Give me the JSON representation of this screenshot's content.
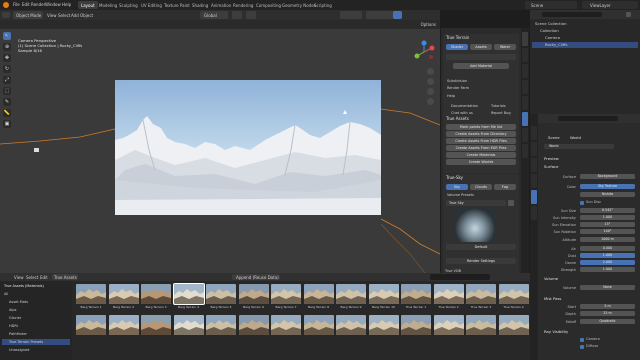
{
  "topbar": {
    "menus": [
      "File",
      "Edit",
      "Render",
      "Window",
      "Help"
    ],
    "workspaces": [
      "Layout",
      "Modeling",
      "Sculpting",
      "UV Editing",
      "Texture Paint",
      "Shading",
      "Animation",
      "Rendering",
      "Compositing",
      "Geometry Nodes",
      "Scripting"
    ],
    "active_workspace": "Layout",
    "scene_label": "Scene",
    "viewlayer_label": "ViewLayer"
  },
  "viewport": {
    "header": {
      "mode": "Object Mode",
      "menus": [
        "View",
        "Select",
        "Add",
        "Object"
      ],
      "orientation": "Global",
      "options": "Options"
    },
    "overlay_text": {
      "line1": "Camera Perspective",
      "line2": "(1) Scene Collection | Rocky_Cliffs",
      "line3": "Sample 8/16"
    },
    "colors": {
      "terrain_edge": "#d07a2a",
      "selection": "#4772b3"
    }
  },
  "npanel": {
    "true_terrain": {
      "title": "True Terrain",
      "tabs": [
        "Shader",
        "Assets",
        "Water"
      ],
      "active_tab": "Shader",
      "add_material": "Add Material",
      "subpanels": [
        "Subdivision",
        "Render Farm",
        "Help"
      ],
      "doc_button": "Documentation",
      "tutorials_button": "Tutorials",
      "chat_button": "Chat with us",
      "report_button": "Report Bug"
    },
    "true_assets": {
      "title": "True Assets",
      "buttons": [
        "Mark points from file list",
        "Create Assets From Directory",
        "Create Assets From HDR Files",
        "Create Assets From EXR Files",
        "Create Materials",
        "Create Worlds"
      ]
    },
    "true_sky": {
      "title": "True-Sky",
      "tabs": [
        "Sky",
        "Clouds",
        "Fog"
      ],
      "active_tab": "Sky",
      "volume_presets": "Volume Presets",
      "preset_name": "True Sky",
      "default_label": "Default",
      "render_settings": "Render Settings",
      "vdb_label": "True VDB"
    }
  },
  "outliner": {
    "rows": [
      "Scene Collection",
      "Collection",
      "Camera",
      "Rocky_Cliffs"
    ],
    "selected_row": 3
  },
  "properties": {
    "scene": "Scene",
    "world": "World",
    "world_field": "World",
    "preview": "Preview",
    "surface_header": "Surface",
    "surface_label": "Surface",
    "surface_value": "Background",
    "color_label": "Color",
    "color_value": "Sky Texture",
    "sky_type": "Nishita",
    "sun_disc": "Sun Disc",
    "fields": [
      {
        "label": "Sun Size",
        "value": "0.545°"
      },
      {
        "label": "Sun Intensity",
        "value": "1.000"
      },
      {
        "label": "Sun Elevation",
        "value": "15°"
      },
      {
        "label": "Sun Rotation",
        "value": "100°"
      },
      {
        "label": "Altitude",
        "value": "1000 m"
      },
      {
        "label": "Air",
        "value": "0.000"
      },
      {
        "label": "Dust",
        "value": "1.000"
      },
      {
        "label": "Ozone",
        "value": "2.000"
      },
      {
        "label": "Strength",
        "value": "1.000"
      }
    ],
    "volume_header": "Volume",
    "volume_label": "Volume",
    "volume_value": "None",
    "mist_header": "Mist Pass",
    "start_label": "Start",
    "start_value": "5 m",
    "depth_label": "Depth",
    "depth_value": "25 m",
    "falloff_label": "Falloff",
    "falloff_value": "Quadratic",
    "ray_vis_header": "Ray Visibility",
    "camera_check": "Camera",
    "diffuse_check": "Diffuse"
  },
  "assets": {
    "header_menus": [
      "View",
      "Select",
      "Edit"
    ],
    "library": "True Assets",
    "append_mode": "Append (Reuse Data)",
    "sidebar_title": "True Assets (Materials)",
    "categories": [
      "All",
      "Asset Mats",
      "Alps",
      "Glacier",
      "HDRI",
      "Pathfinder",
      "True Terrain Presets",
      "Unassigned"
    ],
    "selected_category": 6,
    "thumb_labels": [
      "Berg Terrain 1",
      "Berg Terrain 2",
      "Berg Terrain 3",
      "Berg Terrain 4",
      "Berg Terrain 5",
      "Berg Terrain 6",
      "Berg Terrain 7",
      "Berg Terrain 8",
      "Berg Terrain 9",
      "Berg Terrain 10",
      "True Terrain 1",
      "True Terrain 2",
      "True Terrain 3",
      "True Terrain 4"
    ],
    "selected_thumb": 3
  }
}
